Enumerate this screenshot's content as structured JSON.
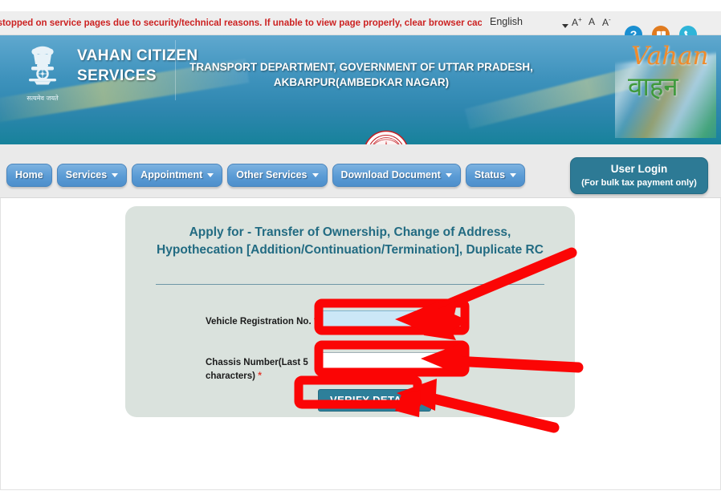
{
  "topbar": {
    "marquee_text": "Some services may be stopped on service pages due to security/technical reasons. If unable to view page properly, clear browser cache.",
    "language_selected": "English",
    "font_increase": "A",
    "font_normal": "A",
    "font_decrease": "A",
    "help_icon_glyph": "?",
    "book_icon_glyph": "■",
    "call_icon_glyph": "✆",
    "icons": [
      {
        "name": "help-icon",
        "color": "#1a8fd1"
      },
      {
        "name": "book-icon",
        "color": "#e07b1f"
      },
      {
        "name": "call-icon",
        "color": "#2fb4d8"
      }
    ]
  },
  "header": {
    "brand_line1": "VAHAN CITIZEN",
    "brand_line2": "SERVICES",
    "emblem_motto": "सत्यमेव जयते",
    "dept_line1": "TRANSPORT DEPARTMENT, GOVERNMENT OF UTTAR PRADESH,",
    "dept_line2": "AKBARPUR(AMBEDKAR NAGAR)",
    "logo_english": "Vahan",
    "logo_hindi": "वाहन",
    "banner_color": "#2d86ae"
  },
  "nav": {
    "items": [
      {
        "label": "Home",
        "has_caret": false
      },
      {
        "label": "Services",
        "has_caret": true
      },
      {
        "label": "Appointment",
        "has_caret": true
      },
      {
        "label": "Other Services",
        "has_caret": true
      },
      {
        "label": "Download Document",
        "has_caret": true
      },
      {
        "label": "Status",
        "has_caret": true
      }
    ],
    "user_login_line1": "User Login",
    "user_login_line2": "(For bulk tax payment only)",
    "user_login_color": "#2d7a95"
  },
  "form_card": {
    "title": "Apply for - Transfer of Ownership, Change of Address, Hypothecation [Addition/Continuation/Termination], Duplicate RC",
    "title_color": "#226b82",
    "background_color": "#dae2dd",
    "fields": [
      {
        "label": "Vehicle Registration No.",
        "required_marker": "*",
        "value": "",
        "placeholder": "",
        "focused": true
      },
      {
        "label": "Chassis Number(Last 5 characters)",
        "required_marker": "*",
        "value": "",
        "placeholder": "",
        "focused": false
      }
    ],
    "submit_label": "VERIFY DETAILS",
    "submit_color": "#2d7f9a"
  },
  "annotations": {
    "color": "#fb0505",
    "shapes": [
      {
        "name": "highlight-box-registration-field",
        "type": "rect"
      },
      {
        "name": "highlight-box-chassis-field",
        "type": "rect"
      },
      {
        "name": "highlight-box-verify-button",
        "type": "rect"
      },
      {
        "name": "arrow-to-registration-field",
        "type": "arrow",
        "direction": "down-left"
      },
      {
        "name": "arrow-to-chassis-field",
        "type": "arrow",
        "direction": "left"
      },
      {
        "name": "arrow-to-verify-button",
        "type": "arrow",
        "direction": "up-left"
      }
    ]
  }
}
